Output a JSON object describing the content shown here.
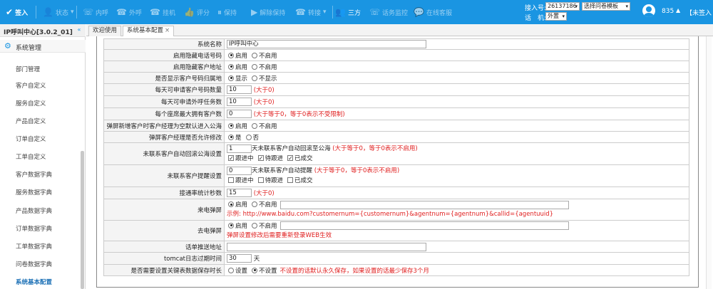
{
  "topbar": {
    "checkin": "签入",
    "status": "状态",
    "internal_call": "内呼",
    "external_call": "外呼",
    "hangup": "挂机",
    "rating": "评分",
    "hold": "保持",
    "unhold": "解除保持",
    "transfer": "转接",
    "three_way": "三方",
    "monitor": "话务监控",
    "online_service": "在线客服",
    "access_label": "接入号:",
    "access_value": "26137186",
    "survey_select": "选择问卷模板",
    "phone_label": "话　机:",
    "phone_value": "外置",
    "user_id": "835",
    "user_status": "【未签入"
  },
  "sidebar": {
    "title": "IP呼叫中心[3.0.2_01]",
    "section": "系统管理",
    "items": [
      "部门管理",
      "客户自定义",
      "服务自定义",
      "产品自定义",
      "订单自定义",
      "工单自定义",
      "客户数据字典",
      "服务数据字典",
      "产品数据字典",
      "订单数据字典",
      "工单数据字典",
      "问卷数据字典",
      "系统基本配置"
    ]
  },
  "tabs": {
    "welcome": "欢迎使用",
    "config": "系统基本配置",
    "close": "×"
  },
  "config": {
    "system_name_label": "系统名称",
    "system_name_value": "IP呼叫中心",
    "hide_phone_label": "启用隐藏电话号码",
    "hide_addr_label": "启用隐藏客户地址",
    "show_region_label": "是否显示客户号码归属地",
    "enable": "启用",
    "disable": "不启用",
    "show": "显示",
    "hide": "不显示",
    "daily_apply_label": "每天可申请客户号码数量",
    "daily_apply_value": "10",
    "daily_apply_hint": "(大于0)",
    "daily_task_label": "每天可申请外呼任务数",
    "daily_task_value": "10",
    "daily_task_hint": "(大于0)",
    "max_clients_label": "每个座席最大拥有客户数",
    "max_clients_value": "0",
    "max_clients_hint": "(大于等于0，等于0表示不受限制)",
    "popup_pool_label": "弹屏新增客户时客户经理为空默认进入公海",
    "popup_manager_label": "弹屏客户经理是否允许修改",
    "yes": "是",
    "no": "否",
    "auto_return_label": "未联系客户自动回滚公海设置",
    "auto_return_value": "1",
    "auto_return_text": "天未联系客户自动回滚至公海",
    "auto_return_hint": "(大于等于0，等于0表示不启用)",
    "following": "跟进中",
    "pending": "待跟进",
    "deal": "已成交",
    "remind_label": "未联系客户提醒设置",
    "remind_value": "0",
    "remind_text": "天未联系客户自动提醒",
    "remind_hint": "(大于等于0，等于0表示不启用)",
    "connect_rate_label": "接通率统计秒数",
    "connect_rate_value": "15",
    "connect_rate_hint": "(大于0)",
    "incoming_popup_label": "来电弹屏",
    "incoming_example": "示例: http://www.baidu.com?customernum={customernum}&agentnum={agentnum}&callid={agentuuid}",
    "outgoing_popup_label": "去电弹屏",
    "outgoing_hint": "弹屏设置修改后需要重新登录WEB生效",
    "push_addr_label": "话单推送地址",
    "tomcat_label": "tomcat日志过期时间",
    "tomcat_value": "30",
    "tomcat_unit": "天",
    "keylog_label": "是否需要设置关键表数据保存时长",
    "set": "设置",
    "not_set": "不设置",
    "keylog_hint": "不设置的话默认永久保存，如果设置的话最少保存3个月"
  }
}
